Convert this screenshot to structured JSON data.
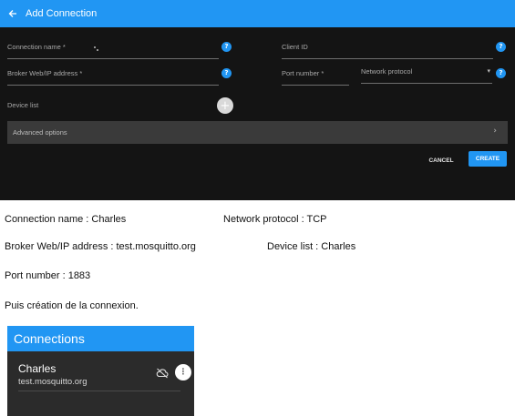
{
  "dialog": {
    "title": "Add Connection",
    "fields": {
      "connection_name": "Connection name *",
      "client_id": "Client ID",
      "broker_address": "Broker Web/IP address *",
      "port_number": "Port number *",
      "network_protocol": "Network protocol"
    },
    "device_list_label": "Device list",
    "advanced_label": "Advanced options",
    "cancel_label": "CANCEL",
    "create_label": "CREATE",
    "info_glyph": "?",
    "add_glyph": "+",
    "chevron_glyph": "›",
    "dropdown_glyph": "▾",
    "icons": [
      "back-arrow-icon",
      "help-icon",
      "add-icon",
      "chevron-right-icon",
      "dropdown-arrow-icon"
    ],
    "colors": {
      "accent": "#2196f3",
      "background": "#141414",
      "panel": "#3a3a3a"
    }
  },
  "summary": {
    "line1_left": "Connection name  : Charles",
    "line1_right": "Network protocol : TCP",
    "line2_left": "Broker Web/IP address : test.mosquitto.org",
    "line2_right": "Device list : Charles",
    "line3": "Port number : 1883",
    "line4": "Puis création de la connexion."
  },
  "connections": {
    "title": "Connections",
    "items": [
      {
        "name": "Charles",
        "host": "test.mosquitto.org"
      }
    ],
    "menu_glyph": "⋮",
    "icons": [
      "cloud-off-icon",
      "more-vert-icon"
    ]
  }
}
